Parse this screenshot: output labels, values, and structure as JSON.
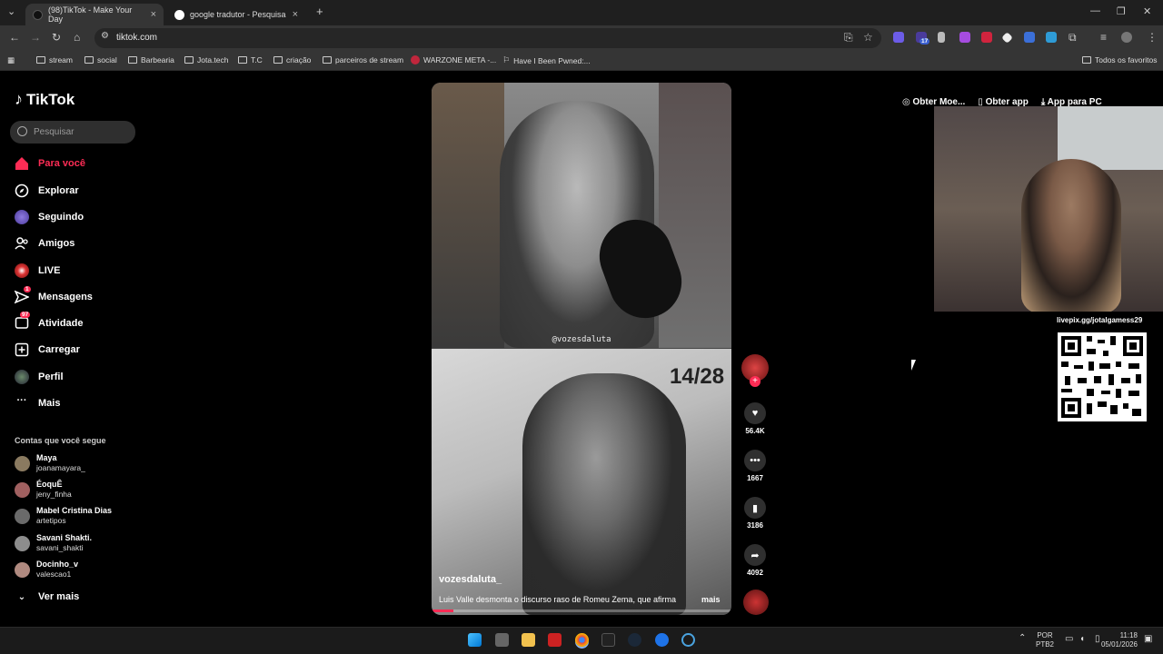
{
  "browser": {
    "tabs": [
      {
        "label": "(98)TikTok - Make Your Day",
        "active": true
      },
      {
        "label": "google tradutor - Pesquisa Goo",
        "active": false
      }
    ],
    "url": "tiktok.com",
    "bookmarks": [
      "stream",
      "social",
      "Barbearia",
      "Jota.tech",
      "T.C",
      "criação",
      "parceiros de stream",
      "WARZONE META -...",
      "Have I Been Pwned:..."
    ],
    "favorites_label": "Todos os favoritos",
    "extension_badge": "17"
  },
  "tiktok": {
    "logo_text": "TikTok",
    "search_placeholder": "Pesquisar",
    "nav": [
      {
        "label": "Para você",
        "icon": "home-icon",
        "active": true
      },
      {
        "label": "Explorar",
        "icon": "compass-icon"
      },
      {
        "label": "Seguindo",
        "icon": "following-icon"
      },
      {
        "label": "Amigos",
        "icon": "friends-icon"
      },
      {
        "label": "LIVE",
        "icon": "live-icon"
      },
      {
        "label": "Mensagens",
        "icon": "messages-icon",
        "badge": "1"
      },
      {
        "label": "Atividade",
        "icon": "activity-icon",
        "badge": "97"
      },
      {
        "label": "Carregar",
        "icon": "upload-icon"
      },
      {
        "label": "Perfil",
        "icon": "profile-icon"
      },
      {
        "label": "Mais",
        "icon": "more-icon"
      }
    ],
    "following_title": "Contas que você segue",
    "following": [
      {
        "name": "Maya",
        "user": "joanamayara_"
      },
      {
        "name": "ÉoquÊ",
        "user": "jeny_finha"
      },
      {
        "name": "Mabel  Cristina  Dias",
        "user": "artetipos"
      },
      {
        "name": "Savani Shakti.",
        "user": "savani_shakti"
      },
      {
        "name": "Docinho_v",
        "user": "valescao1"
      }
    ],
    "see_more": "Ver mais",
    "top_actions": [
      "Obter Moe...",
      "Obter app",
      "App para PC"
    ],
    "video": {
      "watermark": "@vozesdaluta",
      "banner_text": "14/28",
      "author": "vozesdaluta_",
      "description": "Luis Valle desmonta o discurso raso de Romeu Zema, que afirma",
      "more": "mais"
    },
    "actions": {
      "likes": "56.4K",
      "comments": "1667",
      "saves": "3186",
      "shares": "4092"
    }
  },
  "overlay": {
    "qr_label": "livepix.gg/jotalgamess29"
  },
  "taskbar": {
    "lang1": "POR",
    "lang2": "PTB2",
    "time": "11:18",
    "date": "05/01/2026"
  },
  "colors": {
    "accent": "#fe2c55",
    "background": "#000000",
    "browser_chrome": "#353535"
  }
}
